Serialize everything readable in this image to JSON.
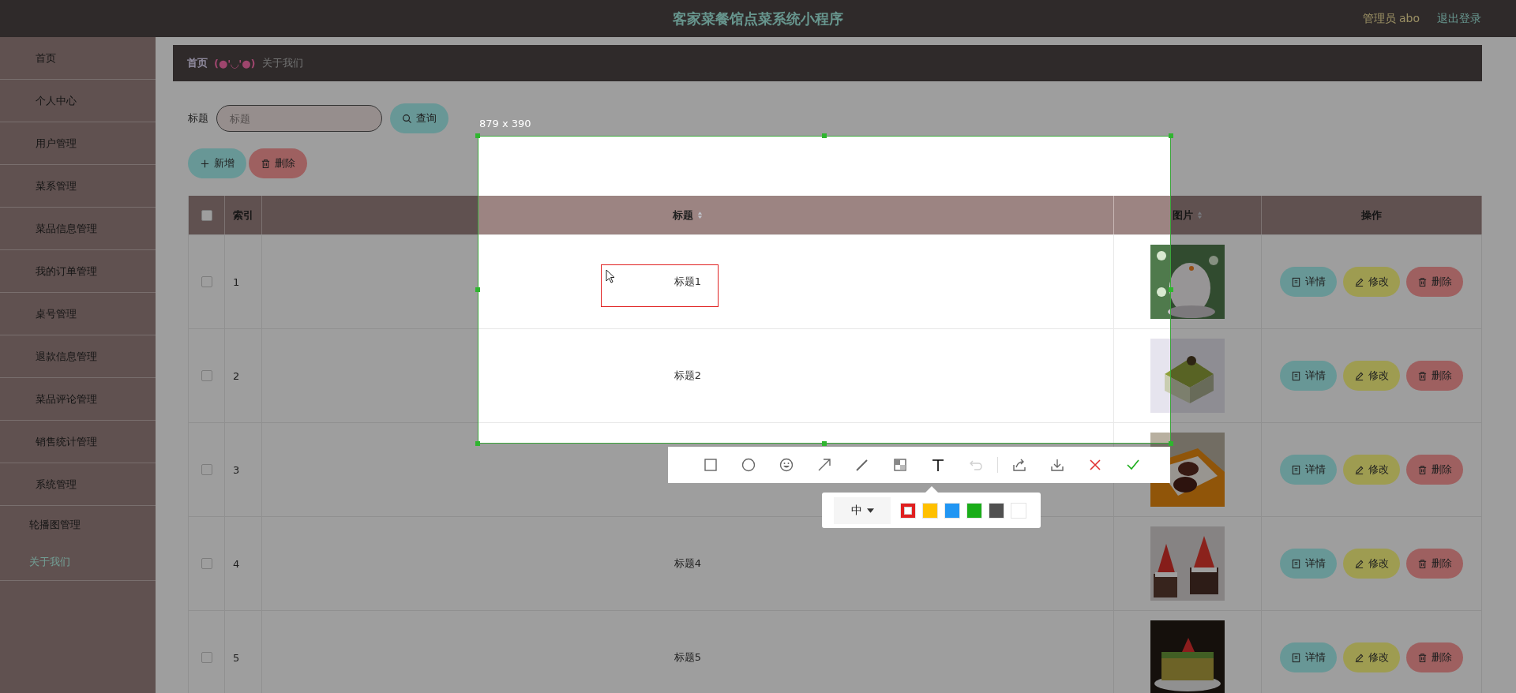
{
  "header": {
    "title": "客家菜餐馆点菜系统小程序",
    "user": "管理员 abo",
    "logout": "退出登录"
  },
  "sidebar": {
    "items": [
      {
        "label": "首页",
        "selected": false
      },
      {
        "label": "个人中心",
        "selected": false
      },
      {
        "label": "用户管理",
        "selected": false
      },
      {
        "label": "菜系管理",
        "selected": false
      },
      {
        "label": "菜品信息管理",
        "selected": false
      },
      {
        "label": "我的订单管理",
        "selected": false
      },
      {
        "label": "桌号管理",
        "selected": false
      },
      {
        "label": "退款信息管理",
        "selected": false
      },
      {
        "label": "菜品评论管理",
        "selected": false
      },
      {
        "label": "销售统计管理",
        "selected": false
      },
      {
        "label": "系统管理",
        "selected": false,
        "children": [
          {
            "label": "轮播图管理",
            "selected": false
          },
          {
            "label": "关于我们",
            "selected": true
          }
        ]
      }
    ]
  },
  "breadcrumb": {
    "home": "首页",
    "emoticon": "(●'◡'●)",
    "current": "关于我们"
  },
  "search": {
    "label": "标题",
    "placeholder": "标题",
    "button": "查询"
  },
  "actions": [
    {
      "label": "新增",
      "kind": "add"
    },
    {
      "label": "删除",
      "kind": "delete"
    }
  ],
  "table": {
    "all_checked": false,
    "columns": [
      {
        "label": "索引",
        "sortable": false
      },
      {
        "label": "标题",
        "sortable": true
      },
      {
        "label": "图片",
        "sortable": true
      },
      {
        "label": "操作",
        "sortable": false
      }
    ],
    "rows": [
      {
        "index": "1",
        "title": "标题1",
        "checked": false,
        "picture": {
          "kind": "picture"
        },
        "actions": [
          {
            "label": "详情",
            "kind": "detail"
          },
          {
            "label": "修改",
            "kind": "edit"
          },
          {
            "label": "删除",
            "kind": "delete"
          }
        ]
      },
      {
        "index": "2",
        "title": "标题2",
        "checked": false,
        "picture": {
          "kind": "picture"
        },
        "actions": [
          {
            "label": "详情",
            "kind": "detail"
          },
          {
            "label": "修改",
            "kind": "edit"
          },
          {
            "label": "删除",
            "kind": "delete"
          }
        ]
      },
      {
        "index": "3",
        "checked": false,
        "picture": {
          "kind": "picture"
        },
        "actions": [
          {
            "label": "详情",
            "kind": "detail"
          },
          {
            "label": "修改",
            "kind": "edit"
          },
          {
            "label": "删除",
            "kind": "delete"
          }
        ]
      },
      {
        "index": "4",
        "title": "标题4",
        "checked": false,
        "picture": {
          "kind": "picture"
        },
        "actions": [
          {
            "label": "详情",
            "kind": "detail"
          },
          {
            "label": "修改",
            "kind": "edit"
          },
          {
            "label": "删除",
            "kind": "delete"
          }
        ]
      },
      {
        "index": "5",
        "title": "标题5",
        "checked": false,
        "picture": {
          "kind": "picture"
        },
        "actions": [
          {
            "label": "详情",
            "kind": "detail"
          },
          {
            "label": "修改",
            "kind": "edit"
          },
          {
            "label": "删除",
            "kind": "delete"
          }
        ]
      }
    ]
  },
  "capture": {
    "size": "879 x 390",
    "tools": [
      {
        "kind": "rectangle",
        "selected": false,
        "disabled": false
      },
      {
        "kind": "ellipse",
        "selected": false,
        "disabled": false
      },
      {
        "kind": "emoji",
        "selected": false,
        "disabled": false
      },
      {
        "kind": "arrow",
        "selected": false,
        "disabled": false
      },
      {
        "kind": "brush",
        "selected": false,
        "disabled": false
      },
      {
        "kind": "mosaic",
        "selected": false,
        "disabled": false
      },
      {
        "kind": "text",
        "selected": true,
        "disabled": false
      },
      {
        "kind": "undo",
        "selected": false,
        "disabled": true
      }
    ],
    "actions": [
      {
        "kind": "share"
      },
      {
        "kind": "download"
      },
      {
        "kind": "cancel"
      },
      {
        "kind": "confirm"
      }
    ],
    "text_options": {
      "size": "中",
      "colors": [
        {
          "color": "#e02020",
          "selected": true
        },
        {
          "color": "#ffc000",
          "selected": false
        },
        {
          "color": "#2196f3",
          "selected": false
        },
        {
          "color": "#1aad19",
          "selected": false
        },
        {
          "color": "#505050",
          "selected": false
        },
        {
          "color": "#ffffff",
          "selected": false
        }
      ]
    }
  }
}
